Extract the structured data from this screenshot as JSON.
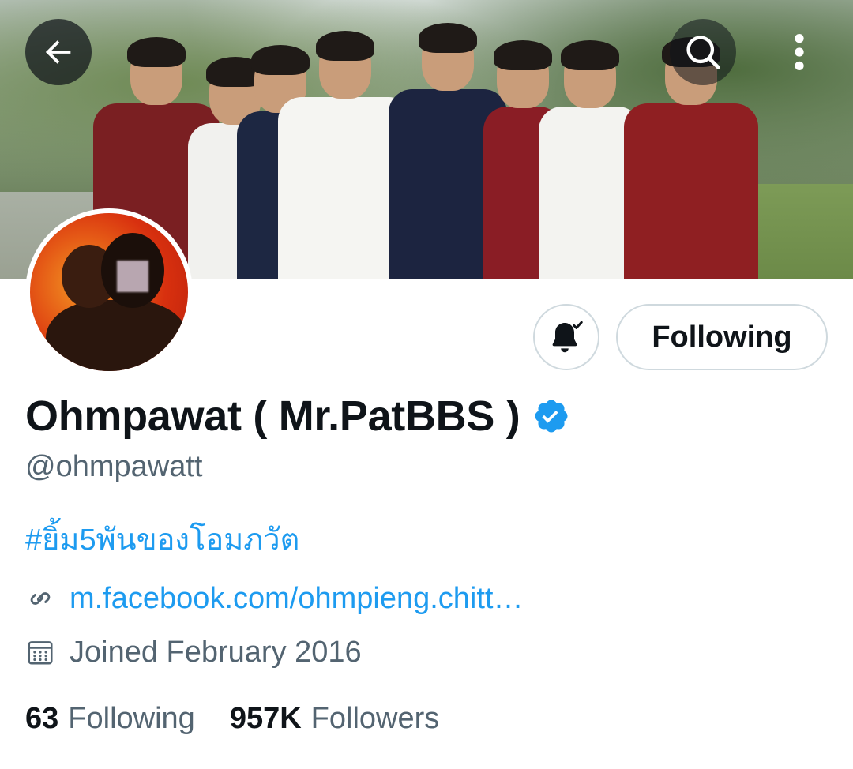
{
  "header": {
    "back_icon": "arrow-left-icon",
    "search_icon": "search-icon",
    "more_icon": "more-vertical-icon"
  },
  "profile": {
    "display_name": "Ohmpawat ( Mr.PatBBS )",
    "verified": true,
    "handle": "@ohmpawatt",
    "bio": "#ยิ้ม5พันของโอมภวัต",
    "link": "m.facebook.com/ohmpieng.chitt…",
    "joined": "Joined February 2016",
    "following_count": "63",
    "following_label": "Following",
    "followers_count": "957K",
    "followers_label": "Followers"
  },
  "actions": {
    "notification_icon": "bell-check-icon",
    "follow_button_label": "Following"
  },
  "colors": {
    "accent": "#1d9bf0",
    "secondary_text": "#536471",
    "primary_text": "#0f1419",
    "border": "#cfd9de"
  }
}
